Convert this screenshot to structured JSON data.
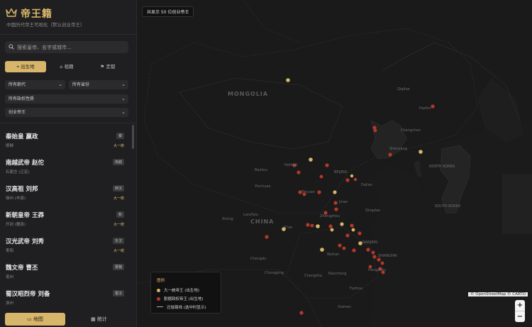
{
  "brand": {
    "title": "帝王籍",
    "subtitle": "中国历代帝王可视化（默认创业帝王）"
  },
  "search": {
    "placeholder": "搜索皇帝、名字或城市..."
  },
  "modes": [
    {
      "label": "出生地",
      "active": true
    },
    {
      "label": "祖籍",
      "active": false
    },
    {
      "label": "定都",
      "active": false
    }
  ],
  "filters": {
    "dynasty": "所有朝代",
    "province": "所有省份",
    "regime": "所有政权性质",
    "type": "创业帝王"
  },
  "emperors": [
    {
      "name": "秦始皇 嬴政",
      "place": "邯郸",
      "dynasty": "秦",
      "kind": "大一统"
    },
    {
      "name": "南越武帝 赵佗",
      "place": "石家庄 (正定)",
      "dynasty": "南越",
      "kind": ""
    },
    {
      "name": "汉高祖 刘邦",
      "place": "徐州 (丰县)",
      "dynasty": "西汉",
      "kind": "大一统"
    },
    {
      "name": "新朝皇帝 王莽",
      "place": "开封 (魏县)",
      "dynasty": "新",
      "kind": "大一统"
    },
    {
      "name": "汉光武帝 刘秀",
      "place": "枣阳",
      "dynasty": "东汉",
      "kind": "大一统"
    },
    {
      "name": "魏文帝 曹丕",
      "place": "亳州",
      "dynasty": "曹魏",
      "kind": ""
    },
    {
      "name": "蜀汉昭烈帝 刘备",
      "place": "涿州",
      "dynasty": "蜀汉",
      "kind": ""
    }
  ],
  "bottom": {
    "map": "地图",
    "stats": "统计"
  },
  "map": {
    "count_text": "共显示 50 位创业帝王",
    "legend": {
      "title": "图例",
      "unified": "大一统帝王 (出生地)",
      "separatist": "割据政权帝王 (出生地)",
      "route": "迁徙路线 (选中时显示)"
    },
    "attribution": "© OpenStreetMap © CARTO",
    "zoom_in": "+",
    "zoom_out": "−",
    "labels": {
      "mongolia": "MONGOLIA",
      "china": "CHINA",
      "north_korea": "NORTH KOREA",
      "south_korea": "SOUTH KOREA",
      "beijing": "BEIJING",
      "qiqihar": "Qiqihar",
      "harbin": "Harbin",
      "changchun": "Changchun",
      "shenyang": "Shenyang",
      "baotou": "Baotou",
      "hohhot": "Hohhot",
      "taiyuan": "Taiyuan",
      "jinan": "Jinan",
      "zhengzhou": "Zhengzhou",
      "nanjing": "NANJING",
      "shanghai": "SHANGHAI",
      "wuhan": "Wuhan",
      "chengdu": "Chengdu",
      "chongqing": "Chongqing",
      "hangzhou": "Hangzhou",
      "xian": "Xi'an",
      "lanzhou": "Lanzhou",
      "xining": "Xining",
      "yinchuan": "Yinchuan",
      "dalian": "Dalian",
      "qingdao": "Qingdao",
      "changsha": "Changsha",
      "nanchang": "Nanchang",
      "fuzhou": "Fuzhou",
      "xiamen": "Xiamen"
    },
    "colors": {
      "unified": "#d7b56a",
      "separatist": "#b5372b"
    }
  }
}
